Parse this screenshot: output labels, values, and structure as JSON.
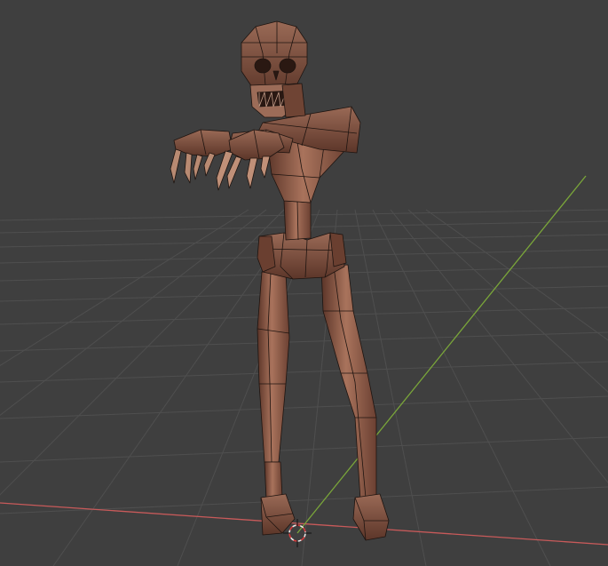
{
  "viewport": {
    "background": "#3f3f3f",
    "grid_color": "#4f4f4f",
    "x_axis_color": "#c85a5a",
    "y_axis_color": "#7aa63a"
  },
  "model": {
    "skin_color": "#8a5a48",
    "skin_light": "#b27a62",
    "skin_dark": "#5a3428",
    "wire_color": "#1e1410"
  },
  "cursor": {
    "icon": "3d-cursor-icon",
    "ring_color": "#e8e8e8",
    "accent_color": "#d8393a"
  }
}
